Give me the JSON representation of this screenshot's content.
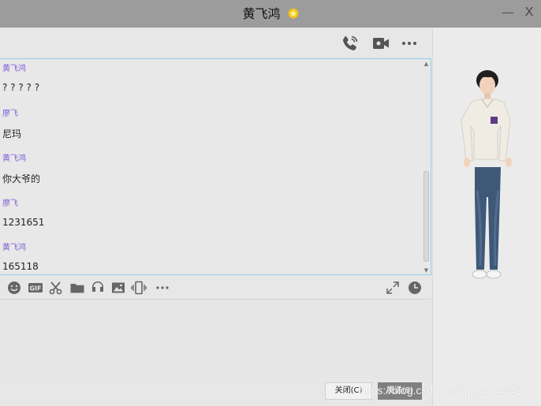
{
  "window": {
    "title": "黄飞鸿",
    "minimize": "—",
    "close": "X"
  },
  "header_icons": [
    "phone-call-icon",
    "video-call-icon",
    "more-icon"
  ],
  "messages": [
    {
      "sender": "黄飞鸿",
      "text": "? ? ? ? ?"
    },
    {
      "sender": "廖飞",
      "text": "尼玛"
    },
    {
      "sender": "黄飞鸿",
      "text": "你大爷的"
    },
    {
      "sender": "廖飞",
      "text": "1231651"
    },
    {
      "sender": "黄飞鸿",
      "text": "165118"
    }
  ],
  "toolbar": {
    "left_icons": [
      "emoji-icon",
      "gif-icon",
      "scissors-icon",
      "folder-icon",
      "music-icon",
      "image-icon",
      "shake-icon",
      "more-icon"
    ],
    "right_icons": [
      "expand-icon",
      "history-clock-icon"
    ]
  },
  "buttons": {
    "close_label": "关闭(C)",
    "send_label": "发送(S)"
  },
  "watermark": "https://blog.csdn.net/qq_49143427",
  "colors": {
    "titlebar": "#9c9c9c",
    "sender_name": "#7a5cd6",
    "chat_border": "#8ecfe2",
    "send_button": "#7f7f7f"
  }
}
